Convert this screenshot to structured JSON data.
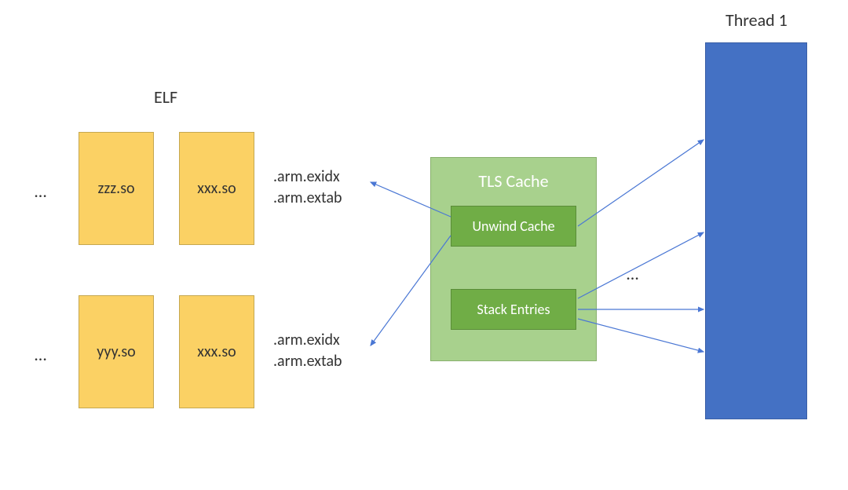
{
  "header": {
    "elf_label": "ELF",
    "thread_label": "Thread 1"
  },
  "elf": {
    "row1": {
      "left": "zzz.so",
      "right": "xxx.so"
    },
    "row2": {
      "left": "yyy.so",
      "right": "xxx.so"
    },
    "ellipsis": "…"
  },
  "annotations": {
    "row1_line1": ".arm.exidx",
    "row1_line2": ".arm.extab",
    "row2_line1": ".arm.exidx",
    "row2_line2": ".arm.extab"
  },
  "tls": {
    "title": "TLS Cache",
    "unwind": "Unwind Cache",
    "stack": "Stack Entries"
  },
  "mid_ellipsis": "…"
}
